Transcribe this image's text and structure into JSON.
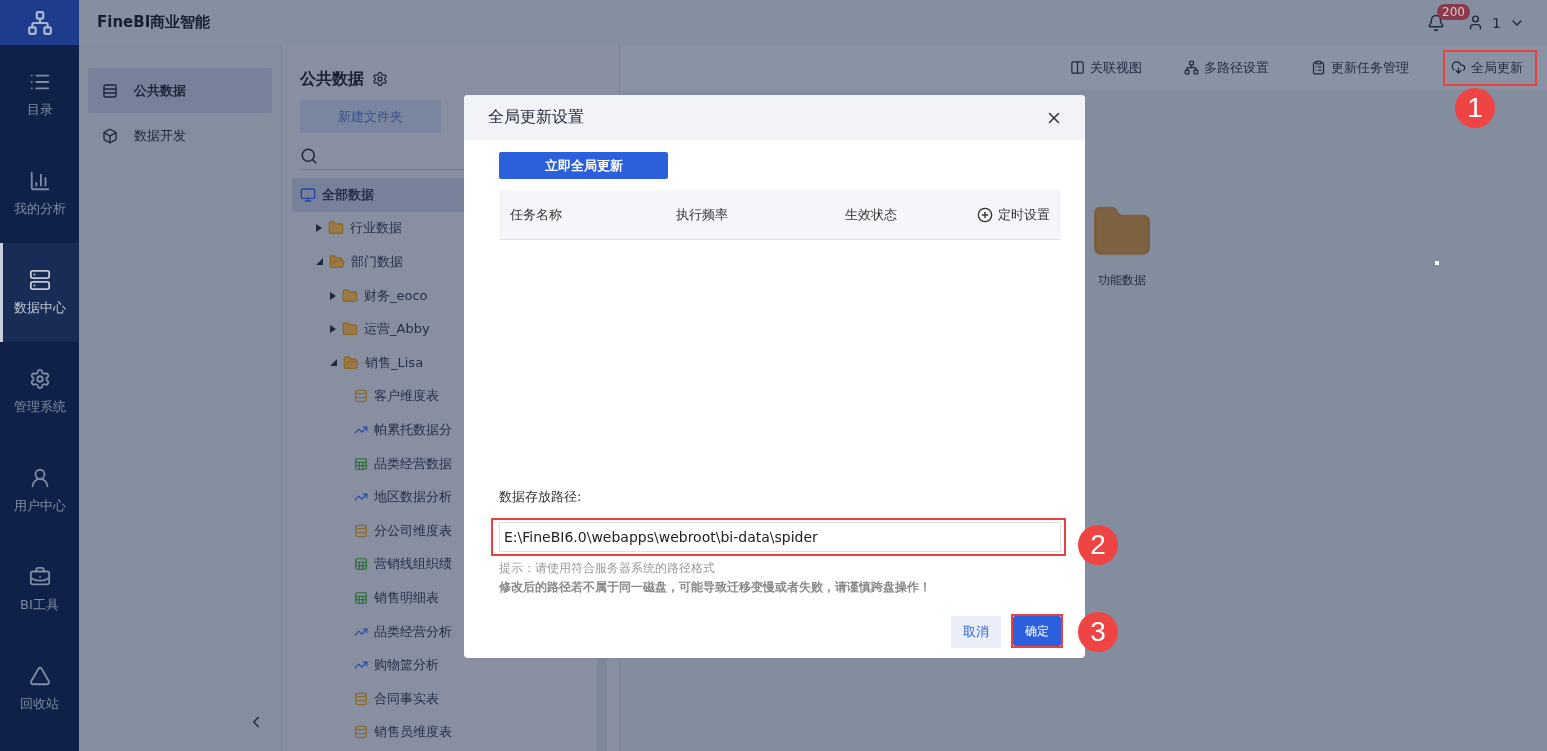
{
  "app": {
    "title": "FineBI商业智能",
    "notification_count": "200",
    "user": "1"
  },
  "nav": [
    {
      "label": "目录",
      "selected": false
    },
    {
      "label": "我的分析",
      "selected": false
    },
    {
      "label": "数据中心",
      "selected": true
    },
    {
      "label": "管理系统",
      "selected": false
    },
    {
      "label": "用户中心",
      "selected": false
    },
    {
      "label": "BI工具",
      "selected": false
    },
    {
      "label": "回收站",
      "selected": false
    }
  ],
  "sidebar": {
    "items": [
      {
        "label": "公共数据",
        "selected": true
      },
      {
        "label": "数据开发",
        "selected": false
      }
    ]
  },
  "tree_panel": {
    "title": "公共数据",
    "new_folder": "新建文件夹",
    "root": {
      "label": "全部数据",
      "selected": true,
      "children": [
        {
          "label": "行业数据",
          "kind": "folder",
          "expanded": false
        },
        {
          "label": "部门数据",
          "kind": "folder",
          "expanded": true,
          "children": [
            {
              "label": "财务_eoco",
              "kind": "folder",
              "expanded": false
            },
            {
              "label": "运营_Abby",
              "kind": "folder",
              "expanded": false
            },
            {
              "label": "销售_Lisa",
              "kind": "folder",
              "expanded": true,
              "children": [
                {
                  "label": "客户维度表",
                  "kind": "sql"
                },
                {
                  "label": "帕累托数据分",
                  "kind": "analysis"
                },
                {
                  "label": "品类经营数据",
                  "kind": "xls"
                },
                {
                  "label": "地区数据分析",
                  "kind": "analysis"
                },
                {
                  "label": "分公司维度表",
                  "kind": "sql"
                },
                {
                  "label": "营销线组织绩",
                  "kind": "xls"
                },
                {
                  "label": "销售明细表",
                  "kind": "xls"
                },
                {
                  "label": "品类经营分析",
                  "kind": "analysis"
                },
                {
                  "label": "购物篮分析",
                  "kind": "analysis"
                },
                {
                  "label": "合同事实表",
                  "kind": "sql"
                },
                {
                  "label": "销售员维度表",
                  "kind": "sql"
                }
              ]
            }
          ]
        }
      ]
    }
  },
  "toolbar": [
    {
      "label": "关联视图",
      "highlighted": false
    },
    {
      "label": "多路径设置",
      "highlighted": false
    },
    {
      "label": "更新任务管理",
      "highlighted": false
    },
    {
      "label": "全局更新",
      "highlighted": true
    }
  ],
  "folders": [
    {
      "label": "功能数据"
    }
  ],
  "dialog": {
    "title": "全局更新设置",
    "update_now": "立即全局更新",
    "columns": [
      "任务名称",
      "执行频率",
      "生效状态"
    ],
    "schedule": "定时设置",
    "path_label": "数据存放路径:",
    "path_value": "E:\\FineBI6.0\\webapps\\webroot\\bi-data\\spider",
    "path_highlighted": true,
    "hint": "提示：请使用符合服务器系统的路径格式",
    "warning": "修改后的路径若不属于同一磁盘，可能导致迁移变慢或者失败，请谨慎跨盘操作！",
    "cancel": "取消",
    "confirm": "确定",
    "confirm_highlighted": true
  },
  "annotations": [
    "1",
    "2",
    "3"
  ]
}
